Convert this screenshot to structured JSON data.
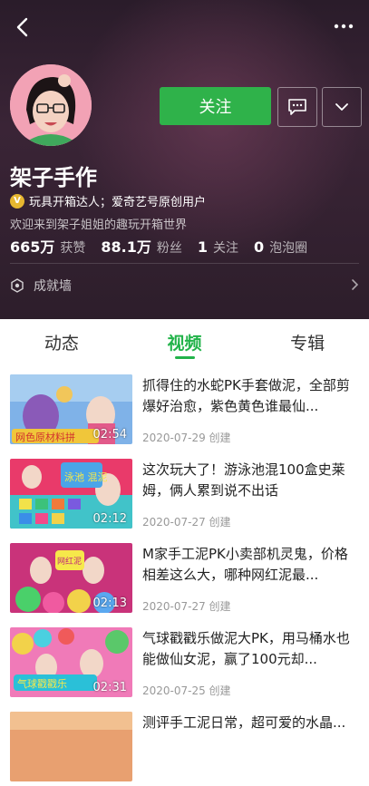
{
  "header": {
    "name": "架子手作",
    "badge_letter": "V",
    "badge_text": "玩具开箱达人；爱奇艺号原创用户",
    "bio": "欢迎来到架子姐姐的趣玩开箱世界",
    "follow_label": "关注",
    "achievement_label": "成就墙",
    "stats": [
      {
        "num": "665万",
        "label": "获赞"
      },
      {
        "num": "88.1万",
        "label": "粉丝"
      },
      {
        "num": "1",
        "label": "关注"
      },
      {
        "num": "0",
        "label": "泡泡圈"
      }
    ]
  },
  "tabs": [
    {
      "label": "动态"
    },
    {
      "label": "视频"
    },
    {
      "label": "专辑"
    }
  ],
  "active_tab": "视频",
  "videos": [
    {
      "title": "抓得住的水蛇PK手套做泥，全部剪爆好治愈，紫色黄色谁最仙...",
      "date": "2020-07-29 创建",
      "duration": "02:54",
      "thumb_text": "网色原材料拼"
    },
    {
      "title": " 这次玩大了！游泳池混100盒史莱姆，俩人累到说不出话",
      "date": "2020-07-27 创建",
      "duration": "02:12",
      "thumb_text": "泳池 混泥"
    },
    {
      "title": "M家手工泥PK小卖部机灵鬼，价格相差这么大，哪种网红泥最...",
      "date": "2020-07-27 创建",
      "duration": "02:13",
      "thumb_text": "网红泥"
    },
    {
      "title": "气球戳戳乐做泥大PK，用马桶水也能做仙女泥，赢了100元却...",
      "date": "2020-07-25 创建",
      "duration": "02:31",
      "thumb_text": "气球戳戳乐"
    },
    {
      "title": "测评手工泥日常，超可爱的水晶...",
      "date": "",
      "duration": "",
      "thumb_text": ""
    }
  ],
  "colors": {
    "accent": "#22b34a",
    "follow_button": "#2fb24a",
    "header_bg": "#2d1e2b"
  }
}
